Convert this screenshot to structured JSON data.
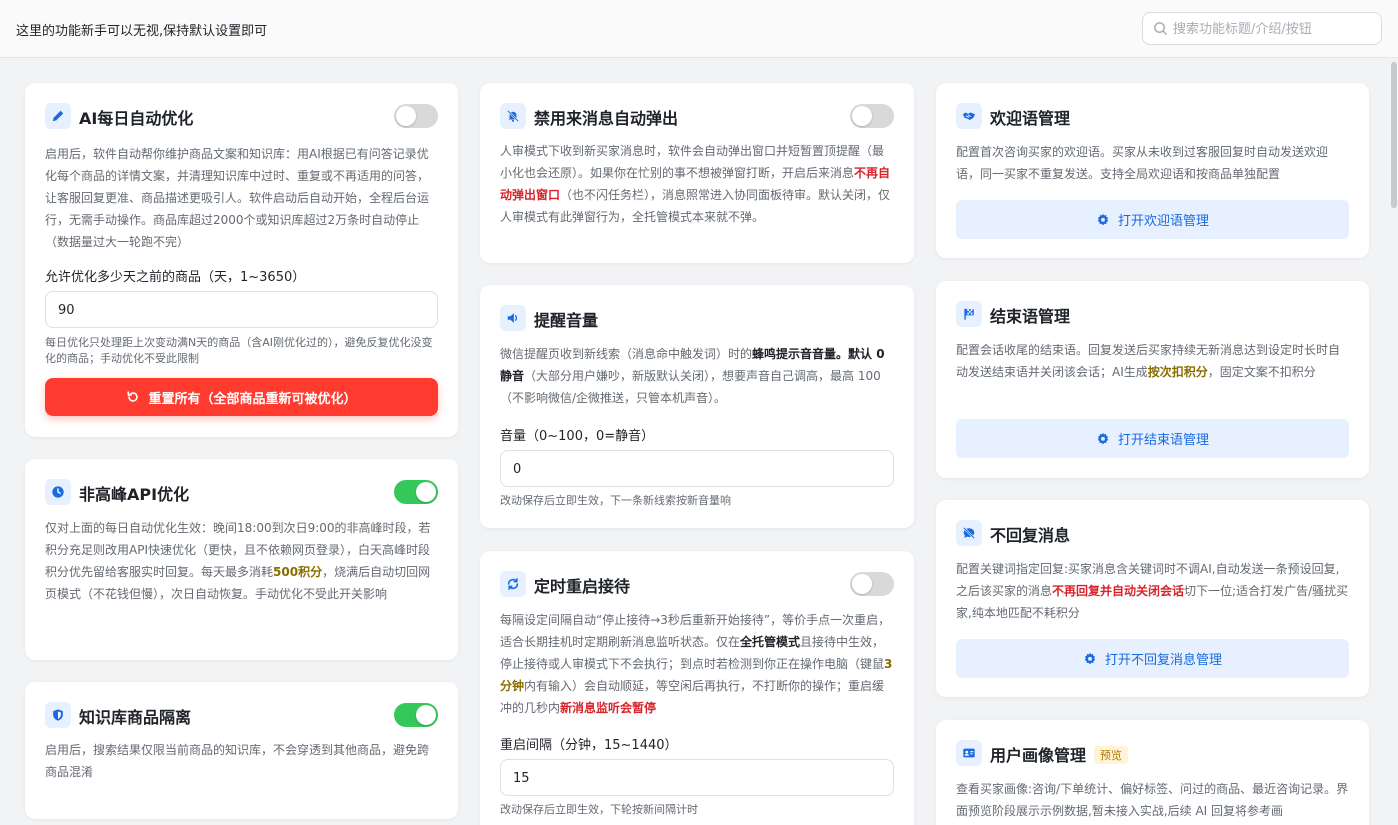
{
  "header": {
    "notice": "这里的功能新手可以无视,保持默认设置即可",
    "search_placeholder": "搜索功能标题/介绍/按钮"
  },
  "cards": {
    "ai_daily": {
      "title": "AI每日自动优化",
      "toggle_on": false,
      "desc": "启用后，软件自动帮你维护商品文案和知识库：用AI根据已有问答记录优化每个商品的详情文案，并清理知识库中过时、重复或不再适用的问答，让客服回复更准、商品描述更吸引人。软件启动后自动开始，全程后台运行，无需手动操作。商品库超过2000个或知识库超过2万条时自动停止（数据量过大一轮跑不完）",
      "field_label": "允许优化多少天之前的商品（天，1~3650）",
      "field_value": "90",
      "hint": "每日优化只处理距上次变动满N天的商品（含AI刚优化过的），避免反复优化没变化的商品；手动优化不受此限制",
      "reset_button": "重置所有（全部商品重新可被优化）"
    },
    "offpeak": {
      "title": "非高峰API优化",
      "toggle_on": true,
      "desc_a": "仅对上面的每日自动优化生效：晚间18:00到次日9:00的非高峰时段，若积分充足则改用API快速优化（更快，且不依赖网页登录），白天高峰时段积分优先留给客服实时回复。每天最多消耗",
      "desc_hl": "500积分",
      "desc_b": "，烧满后自动切回网页模式（不花钱但慢），次日自动恢复。手动优化不受此开关影响"
    },
    "kb_isolation": {
      "title": "知识库商品隔离",
      "toggle_on": true,
      "desc": "启用后，搜索结果仅限当前商品的知识库，不会穿透到其他商品，避免跨商品混淆"
    },
    "no_popup": {
      "title": "禁用来消息自动弹出",
      "toggle_on": false,
      "desc_a": "人审模式下收到新买家消息时，软件会自动弹出窗口并短暂置顶提醒（最小化也会还原）。如果你在忙别的事不想被弹窗打断，开启后来消息",
      "desc_hl": "不再自动弹出窗口",
      "desc_b": "（也不闪任务栏），消息照常进入协同面板待审。默认关闭，仅人审模式有此弹窗行为，全托管模式本来就不弹。"
    },
    "volume": {
      "title": "提醒音量",
      "desc_a": "微信提醒页收到新线索（消息命中触发词）时的",
      "desc_hl": "蜂鸣提示音音量。默认 0 静音",
      "desc_b": "（大部分用户嫌吵，新版默认关闭），想要声音自己调高，最高 100（不影响微信/企微推送，只管本机声音）。",
      "field_label": "音量（0~100，0=静音）",
      "field_value": "0",
      "hint": "改动保存后立即生效，下一条新线索按新音量响"
    },
    "restart": {
      "title": "定时重启接待",
      "toggle_on": false,
      "desc_a": "每隔设定间隔自动“停止接待→3秒后重新开始接待”，等价手点一次重启，适合长期挂机时定期刷新消息监听状态。仅在",
      "desc_hl1": "全托管模式",
      "desc_b": "且接待中生效，停止接待或人审模式下不会执行；到点时若检测到你正在操作电脑（键鼠",
      "desc_hl2": "3分钟",
      "desc_c": "内有输入）会自动顺延，等空闲后再执行，不打断你的操作；重启缓冲的几秒内",
      "desc_hl3": "新消息监听会暂停",
      "field_label": "重启间隔（分钟，15~1440）",
      "field_value": "15",
      "hint": "改动保存后立即生效，下轮按新间隔计时"
    },
    "welcome": {
      "title": "欢迎语管理",
      "desc": "配置首次咨询买家的欢迎语。买家从未收到过客服回复时自动发送欢迎语，同一买家不重复发送。支持全局欢迎语和按商品单独配置",
      "button": "打开欢迎语管理"
    },
    "closing": {
      "title": "结束语管理",
      "desc_a": "配置会话收尾的结束语。回复发送后买家持续无新消息达到设定时长时自动发送结束语并关闭该会话；AI生成",
      "desc_hl": "按次扣积分",
      "desc_b": "，固定文案不扣积分",
      "button": "打开结束语管理"
    },
    "no_reply": {
      "title": "不回复消息",
      "desc_a": "配置关键词指定回复:买家消息含关键词时不调AI,自动发送一条预设回复,之后该买家的消息",
      "desc_hl": "不再回复并自动关闭会话",
      "desc_b": "切下一位;适合打发广告/骚扰买家,纯本地匹配不耗积分",
      "button": "打开不回复消息管理"
    },
    "profile": {
      "title": "用户画像管理",
      "badge": "预览",
      "desc": "查看买家画像:咨询/下单统计、偏好标签、问过的商品、最近咨询记录。界面预览阶段展示示例数据,暂未接入实战,后续 AI 回复将参考画"
    }
  },
  "colors": {
    "accent": "#1a6ae0",
    "toggle_on": "#34c759",
    "danger": "#ff3b30",
    "icon_bg": "#e6f0ff"
  }
}
